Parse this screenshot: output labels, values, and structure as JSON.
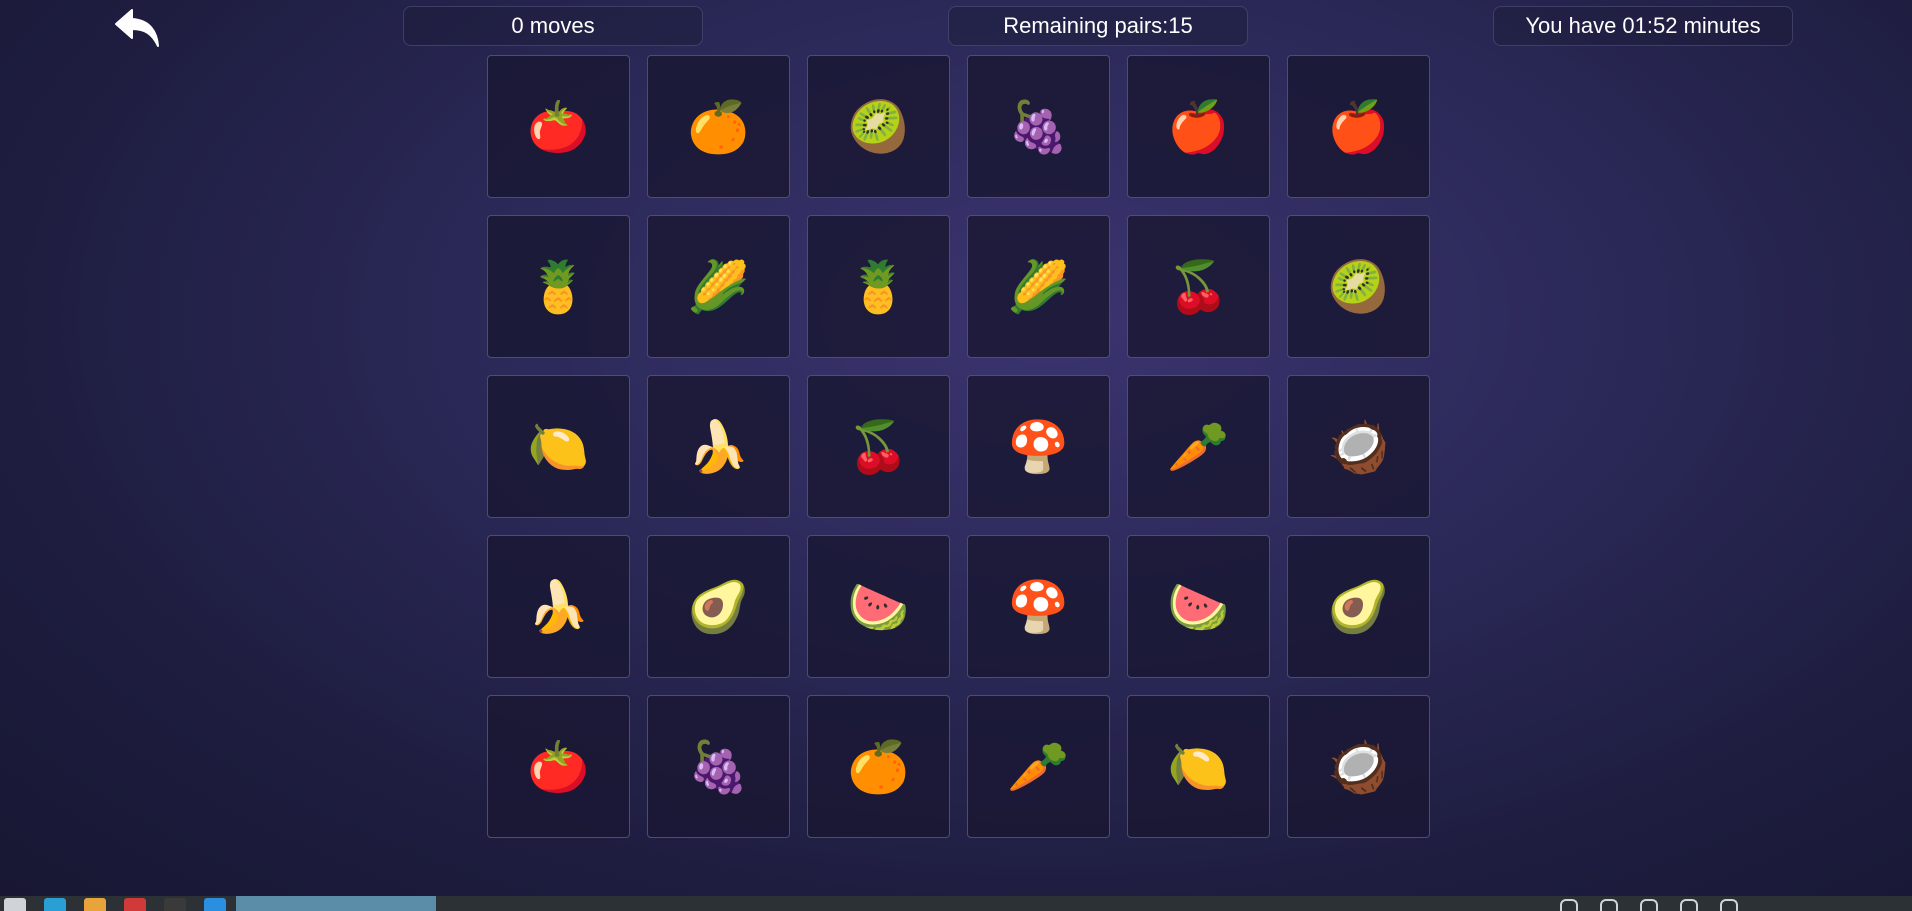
{
  "header": {
    "moves": "0 moves",
    "remaining_pairs": "Remaining pairs:15",
    "timer": "You have 01:52 minutes"
  },
  "board": {
    "cards": [
      {
        "emoji": "🍅",
        "name": "tomato"
      },
      {
        "emoji": "🍊",
        "name": "orange"
      },
      {
        "emoji": "🥝",
        "name": "kiwi"
      },
      {
        "emoji": "🍇",
        "name": "grapes"
      },
      {
        "emoji": "🍎",
        "name": "apple"
      },
      {
        "emoji": "🍎",
        "name": "apple"
      },
      {
        "emoji": "🍍",
        "name": "pineapple"
      },
      {
        "emoji": "🌽",
        "name": "corn"
      },
      {
        "emoji": "🍍",
        "name": "pineapple"
      },
      {
        "emoji": "🌽",
        "name": "corn"
      },
      {
        "emoji": "🍒",
        "name": "cherries"
      },
      {
        "emoji": "🥝",
        "name": "kiwi"
      },
      {
        "emoji": "🍋",
        "name": "lemon"
      },
      {
        "emoji": "🍌",
        "name": "banana"
      },
      {
        "emoji": "🍒",
        "name": "cherries"
      },
      {
        "emoji": "🍄",
        "name": "mushroom"
      },
      {
        "emoji": "🥕",
        "name": "carrot"
      },
      {
        "emoji": "🥥",
        "name": "coconut"
      },
      {
        "emoji": "🍌",
        "name": "banana"
      },
      {
        "emoji": "🥑",
        "name": "avocado"
      },
      {
        "emoji": "🍉",
        "name": "watermelon"
      },
      {
        "emoji": "🍄",
        "name": "mushroom"
      },
      {
        "emoji": "🍉",
        "name": "watermelon"
      },
      {
        "emoji": "🥑",
        "name": "avocado"
      },
      {
        "emoji": "🍅",
        "name": "tomato"
      },
      {
        "emoji": "🍇",
        "name": "grapes"
      },
      {
        "emoji": "🍊",
        "name": "orange"
      },
      {
        "emoji": "🥕",
        "name": "carrot"
      },
      {
        "emoji": "🍋",
        "name": "lemon"
      },
      {
        "emoji": "🥥",
        "name": "coconut"
      }
    ]
  },
  "taskbar": {
    "launchers": [
      {
        "icon": "app-menu-icon",
        "color": "#d0d4d8"
      },
      {
        "icon": "browser-icon",
        "color": "#2a9fd6"
      },
      {
        "icon": "file-manager-icon",
        "color": "#e8a33a"
      },
      {
        "icon": "app-icon",
        "color": "#d23a3a"
      },
      {
        "icon": "terminal-icon",
        "color": "#3a3a3a"
      },
      {
        "icon": "folder-icon",
        "color": "#2a8fe0"
      }
    ],
    "tray_icons": [
      "network-icon",
      "bluetooth-icon",
      "shield-icon",
      "battery-icon",
      "volume-icon"
    ]
  },
  "colors": {
    "accent": "#5b8ca8",
    "card_bg": "#1a1834",
    "text": "#ffffff"
  }
}
